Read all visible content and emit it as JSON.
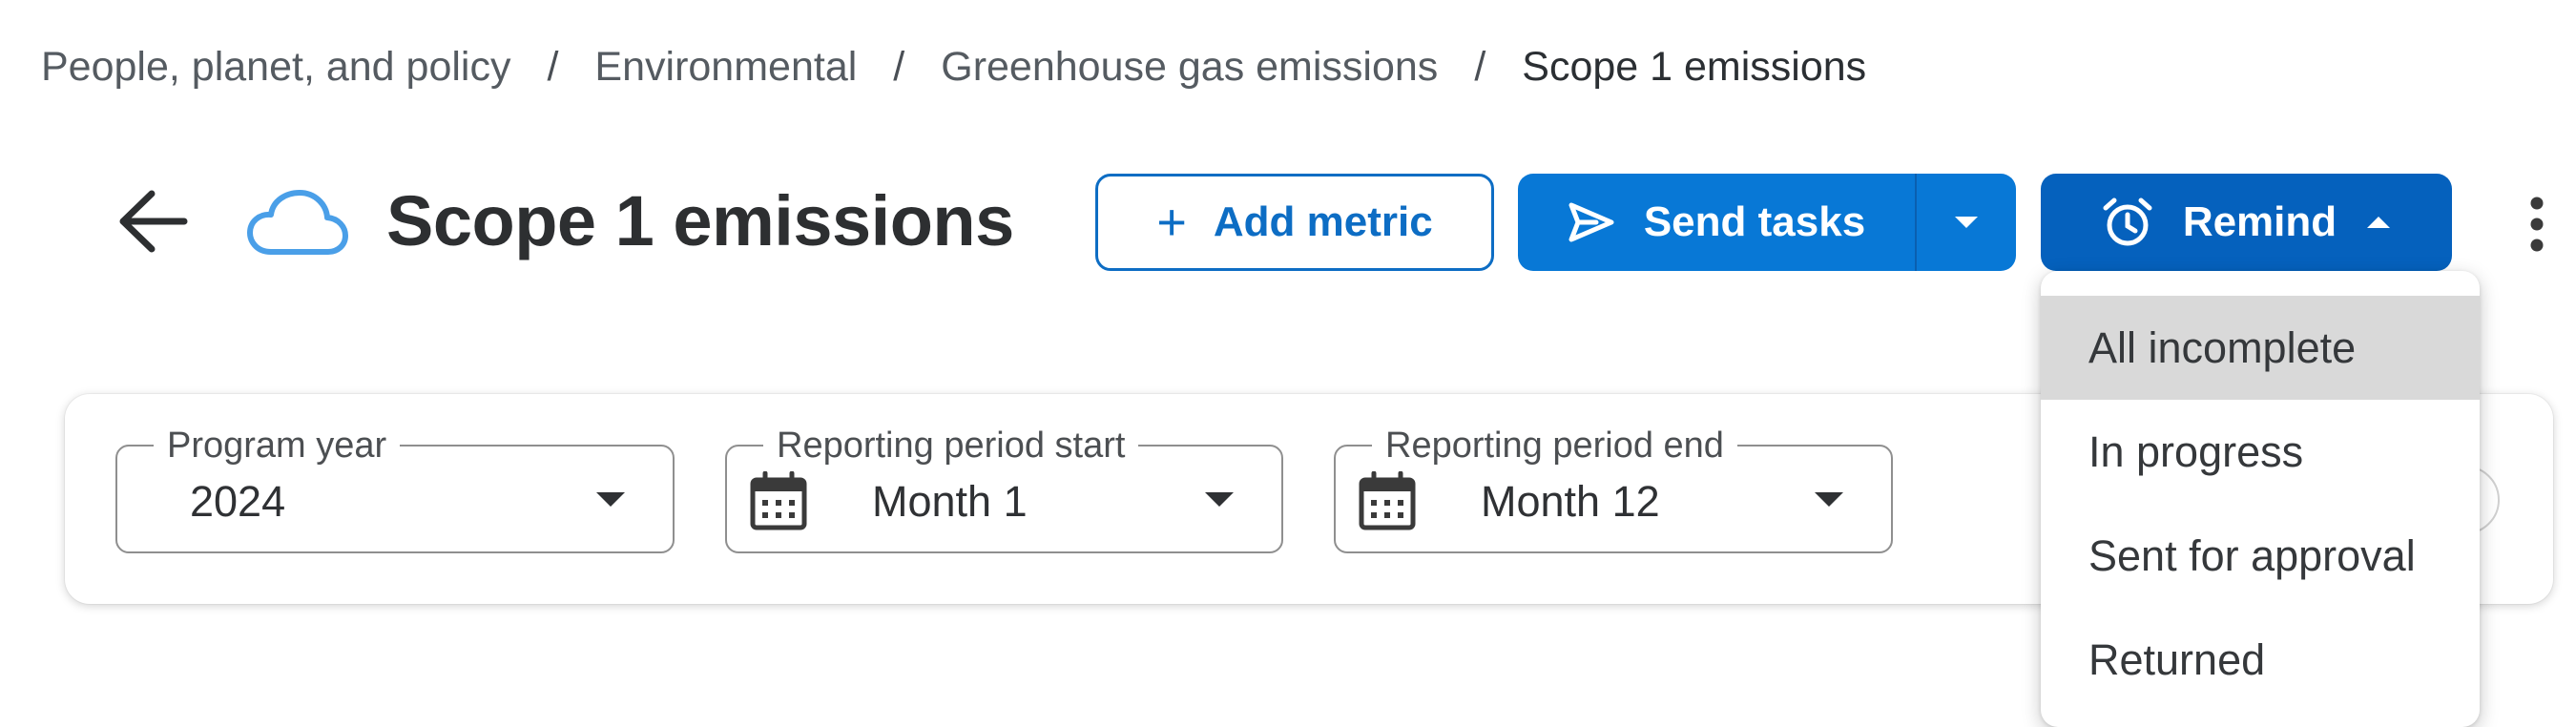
{
  "breadcrumb": {
    "items": [
      "People, planet, and policy",
      "Environmental",
      "Greenhouse gas emissions"
    ],
    "separator": "/",
    "current": "Scope 1 emissions"
  },
  "header": {
    "title": "Scope 1 emissions",
    "icon": "cloud-icon",
    "add_metric_label": "Add metric",
    "send_tasks_label": "Send tasks",
    "remind_label": "Remind"
  },
  "filters": {
    "program_year": {
      "label": "Program year",
      "value": "2024"
    },
    "period_start": {
      "label": "Reporting period start",
      "value": "Month 1"
    },
    "period_end": {
      "label": "Reporting period end",
      "value": "Month 12"
    }
  },
  "remind_menu": {
    "items": [
      "All incomplete",
      "In progress",
      "Sent for approval",
      "Returned"
    ],
    "highlighted_index": 0
  },
  "colors": {
    "primary": "#0878d6",
    "primary_dark": "#0561bd",
    "outline": "#0d6dc4",
    "cloud": "#4a9fe8",
    "menu_highlight": "#d9d9d9"
  }
}
